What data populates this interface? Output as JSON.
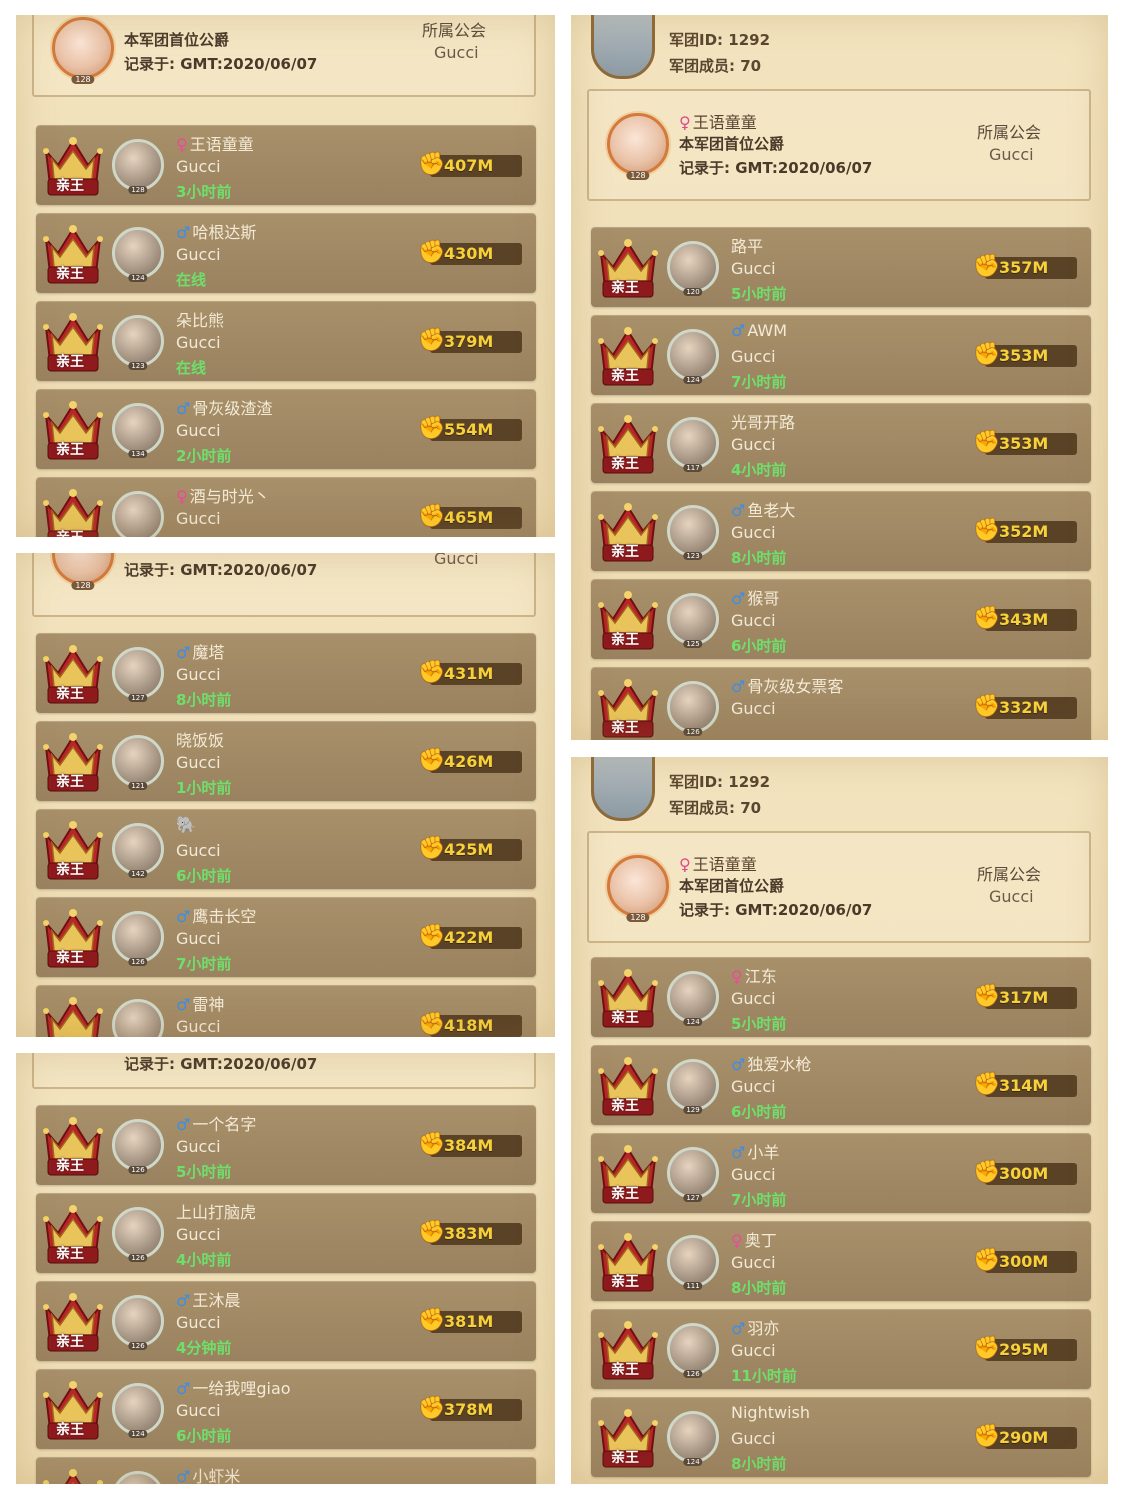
{
  "rank_label": "亲王",
  "header": {
    "leader_name": "王语童童",
    "leader_title": "本军团首位公爵",
    "record_date": "记录于: GMT:2020/06/07",
    "guild_label": "所属公会",
    "guild_value": "Gucci",
    "leader_level": "128",
    "legion_id": "军团ID: 1292",
    "legion_members": "军团成员: 70"
  },
  "panel_a_rows": [
    {
      "gender": "female",
      "name": "王语童童",
      "guild": "Gucci",
      "status": "3小时前",
      "power": "407M",
      "level": "128"
    },
    {
      "gender": "male",
      "name": "哈根达斯",
      "guild": "Gucci",
      "status": "在线",
      "power": "430M",
      "level": "124"
    },
    {
      "gender": "",
      "name": "朵比熊",
      "guild": "Gucci",
      "status": "在线",
      "power": "379M",
      "level": "123"
    },
    {
      "gender": "male",
      "name": "骨灰级渣渣",
      "guild": "Gucci",
      "status": "2小时前",
      "power": "554M",
      "level": "134"
    },
    {
      "gender": "female",
      "name": "酒与时光丶",
      "guild": "Gucci",
      "status": "",
      "power": "465M",
      "level": "131"
    }
  ],
  "panel_b_rows": [
    {
      "gender": "male",
      "name": "魔塔",
      "guild": "Gucci",
      "status": "8小时前",
      "power": "431M",
      "level": "127"
    },
    {
      "gender": "",
      "name": "晓饭饭",
      "guild": "Gucci",
      "status": "1小时前",
      "power": "426M",
      "level": "121"
    },
    {
      "gender": "",
      "name": "🐘",
      "guild": "Gucci",
      "status": "6小时前",
      "power": "425M",
      "level": "142"
    },
    {
      "gender": "male",
      "name": "鹰击长空",
      "guild": "Gucci",
      "status": "7小时前",
      "power": "422M",
      "level": "126"
    },
    {
      "gender": "male",
      "name": "雷神",
      "guild": "Gucci",
      "status": "",
      "power": "418M",
      "level": "125"
    }
  ],
  "panel_c_rows": [
    {
      "gender": "male",
      "name": "一个名字",
      "guild": "Gucci",
      "status": "5小时前",
      "power": "384M",
      "level": "126"
    },
    {
      "gender": "",
      "name": "上山打脑虎",
      "guild": "Gucci",
      "status": "4小时前",
      "power": "383M",
      "level": "126"
    },
    {
      "gender": "male",
      "name": "王沐晨",
      "guild": "Gucci",
      "status": "4分钟前",
      "power": "381M",
      "level": "126"
    },
    {
      "gender": "male",
      "name": "一给我哩giao",
      "guild": "Gucci",
      "status": "6小时前",
      "power": "378M",
      "level": "124"
    },
    {
      "gender": "male",
      "name": "小虾米",
      "guild": "",
      "status": "",
      "power": "",
      "level": ""
    }
  ],
  "panel_d_rows": [
    {
      "gender": "",
      "name": "路平",
      "guild": "Gucci",
      "status": "5小时前",
      "power": "357M",
      "level": "120"
    },
    {
      "gender": "male",
      "name": "AWM",
      "guild": "Gucci",
      "status": "7小时前",
      "power": "353M",
      "level": "124"
    },
    {
      "gender": "",
      "name": "光哥开路",
      "guild": "Gucci",
      "status": "4小时前",
      "power": "353M",
      "level": "117"
    },
    {
      "gender": "male",
      "name": "鱼老大",
      "guild": "Gucci",
      "status": "8小时前",
      "power": "352M",
      "level": "123"
    },
    {
      "gender": "male",
      "name": "猴哥",
      "guild": "Gucci",
      "status": "6小时前",
      "power": "343M",
      "level": "125"
    },
    {
      "gender": "male",
      "name": "骨灰级女票客",
      "guild": "Gucci",
      "status": "",
      "power": "332M",
      "level": "126"
    }
  ],
  "panel_e_rows": [
    {
      "gender": "female",
      "name": "江东",
      "guild": "Gucci",
      "status": "5小时前",
      "power": "317M",
      "level": "124"
    },
    {
      "gender": "male",
      "name": "独爱水枪",
      "guild": "Gucci",
      "status": "6小时前",
      "power": "314M",
      "level": "129"
    },
    {
      "gender": "male",
      "name": "小羊",
      "guild": "Gucci",
      "status": "7小时前",
      "power": "300M",
      "level": "127"
    },
    {
      "gender": "female",
      "name": "奥丁",
      "guild": "Gucci",
      "status": "8小时前",
      "power": "300M",
      "level": "111"
    },
    {
      "gender": "male",
      "name": "羽亦",
      "guild": "Gucci",
      "status": "11小时前",
      "power": "295M",
      "level": "126"
    },
    {
      "gender": "",
      "name": "Nightwish",
      "guild": "Gucci",
      "status": "8小时前",
      "power": "290M",
      "level": "124"
    }
  ]
}
